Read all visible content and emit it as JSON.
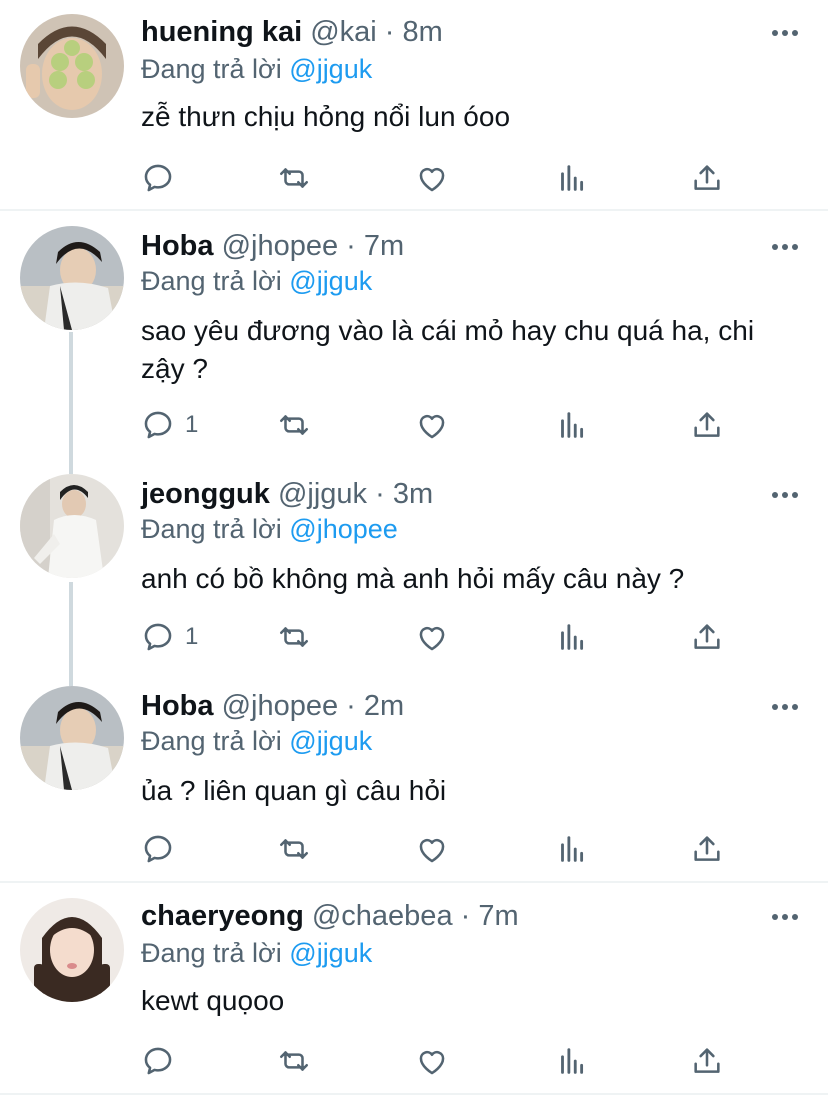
{
  "reply_prefix": "Đang trả lời",
  "tweets": [
    {
      "name": "huening kai",
      "handle": "@kai",
      "time": "8m",
      "reply_to": "@jjguk",
      "text": "zễ thưn chịu hỏng nổi lun óoo",
      "reply_count": ""
    },
    {
      "name": "Hoba",
      "handle": "@jhopee",
      "time": "7m",
      "reply_to": "@jjguk",
      "text": "sao yêu đương vào là cái mỏ hay chu quá ha, chi zậy ?",
      "reply_count": "1"
    },
    {
      "name": "jeongguk",
      "handle": "@jjguk",
      "time": "3m",
      "reply_to": "@jhopee",
      "text": "anh có bồ không mà anh hỏi mấy câu này ?",
      "reply_count": "1"
    },
    {
      "name": "Hoba",
      "handle": "@jhopee",
      "time": "2m",
      "reply_to": "@jjguk",
      "text": "ủa ? liên quan gì câu hỏi",
      "reply_count": ""
    },
    {
      "name": "chaeryeong",
      "handle": "@chaebea",
      "time": "7m",
      "reply_to": "@jjguk",
      "text": "kewt quọoo",
      "reply_count": ""
    }
  ],
  "separator": "·",
  "icons": {
    "reply": "reply-icon",
    "retweet": "retweet-icon",
    "like": "heart-icon",
    "views": "analytics-icon",
    "share": "share-icon",
    "more": "more-icon"
  },
  "colors": {
    "mention": "#1d9bf0",
    "meta": "#536471",
    "thread_line": "#cfd9de"
  }
}
